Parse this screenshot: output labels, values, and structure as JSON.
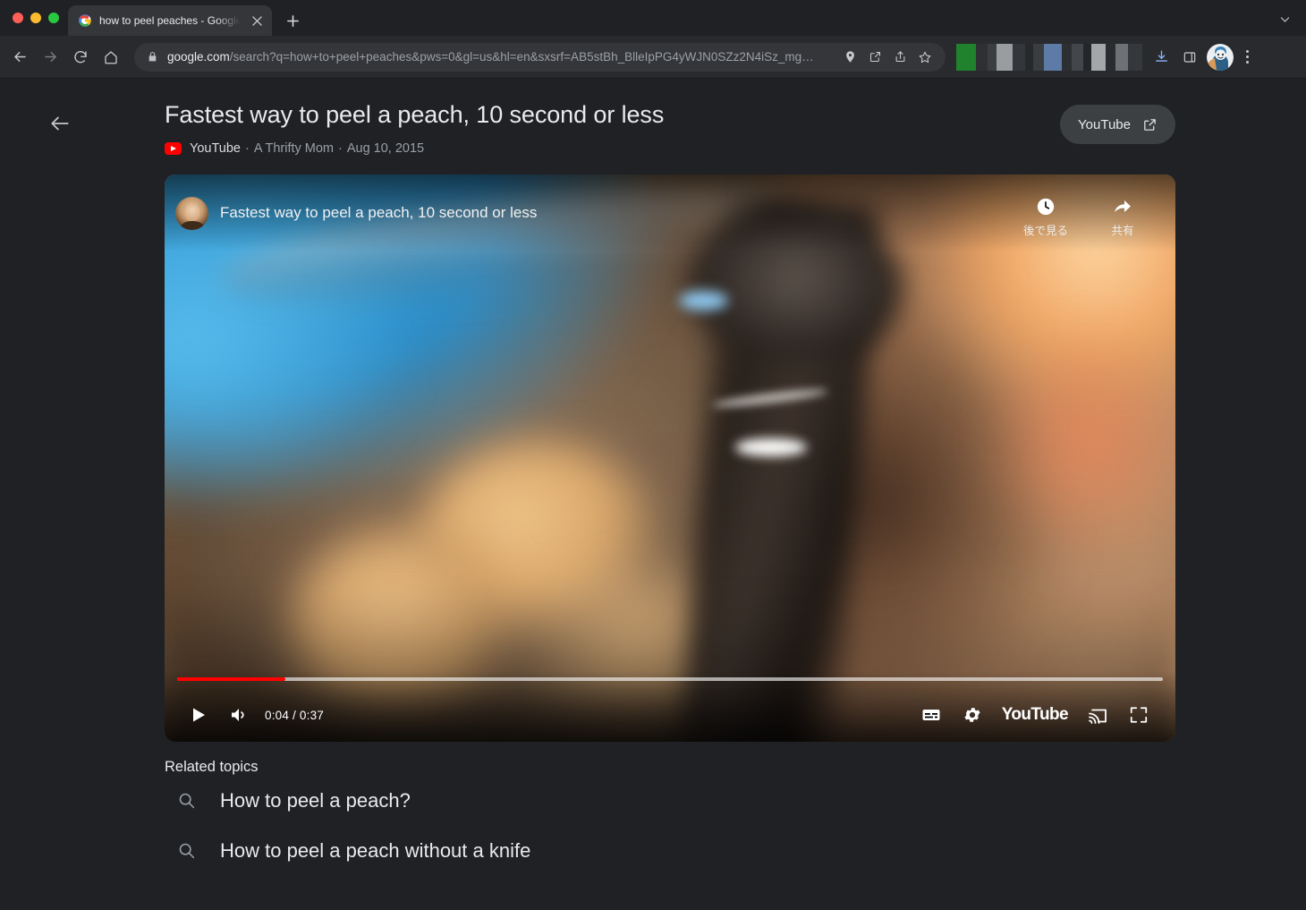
{
  "window": {
    "traffic_lights": [
      "close",
      "minimize",
      "maximize"
    ]
  },
  "tabs": [
    {
      "title": "how to peel peaches - Google S",
      "favicon": "google-icon",
      "active": true
    }
  ],
  "toolbar": {
    "back": "back-arrow",
    "forward": "forward-arrow",
    "reload": "reload-icon",
    "home": "home-icon",
    "url_host": "google.com",
    "url_path": "/search?q=how+to+peel+peaches&pws=0&gl=us&hl=en&sxsrf=AB5stBh_BlleIpPG4yWJN0SZz2N4iSz_mg…",
    "url_full": "google.com/search?q=how+to+peel+peaches&pws=0&gl=us&hl=en&sxsrf=AB5stBh_BlleIpPG4yWJN0SZz2N4iSz_mg…",
    "omnibox_icons": [
      "location-pin-icon",
      "open-in-new-icon",
      "share-icon",
      "bookmark-star-icon"
    ],
    "right_icons": [
      "download-icon",
      "side-panel-icon",
      "profile-avatar",
      "three-dot-menu"
    ],
    "new_tab_label": "+",
    "tab_search_label": "⌄"
  },
  "page": {
    "back_button": "back-arrow",
    "title": "Fastest way to peel a peach, 10 second or less",
    "source": "YouTube",
    "channel": "A Thrifty Mom",
    "date": "Aug 10, 2015",
    "separator": "·",
    "open_button": {
      "label": "YouTube",
      "icon": "open-in-new-icon"
    }
  },
  "player": {
    "overlay_title": "Fastest way to peel a peach, 10 second or less",
    "channel_avatar": "channel-avatar",
    "top_actions": [
      {
        "icon": "watch-later-clock-icon",
        "label": "後で見る"
      },
      {
        "icon": "share-arrow-icon",
        "label": "共有"
      }
    ],
    "progress_percent": 11,
    "current_time": "0:04",
    "duration": "0:37",
    "time_display": "0:04 / 0:37",
    "play_label": "play-button",
    "mute_label": "volume-button",
    "right_controls": [
      "captions-icon",
      "settings-gear-icon",
      "youtube-wordmark",
      "cast-icon",
      "fullscreen-icon"
    ],
    "youtube_wordmark": "YouTube",
    "accent_color": "#ff0000"
  },
  "related": {
    "heading": "Related topics",
    "items": [
      {
        "icon": "search-icon",
        "label": "How to peel a peach?"
      },
      {
        "icon": "search-icon",
        "label": "How to peel a peach without a knife"
      }
    ]
  },
  "colors": {
    "page_background": "#202124",
    "toolbar_background": "#292a2d",
    "tab_active": "#35363a",
    "text_primary": "#e8eaed",
    "text_secondary": "#9aa0a6",
    "youtube_red": "#ff0000"
  }
}
